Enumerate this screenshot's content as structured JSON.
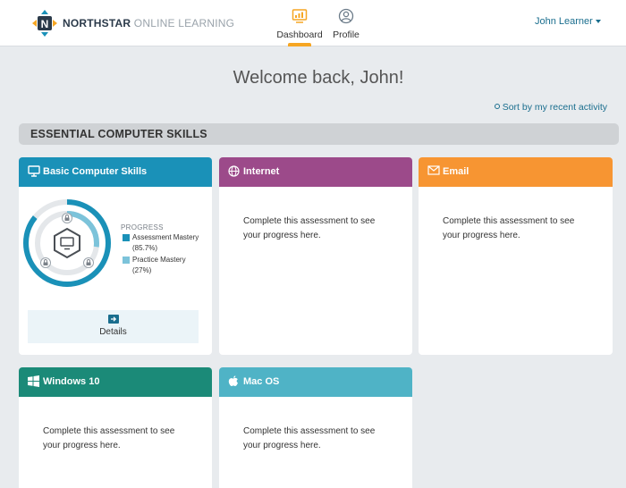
{
  "header": {
    "brand_bold": "NORTHSTAR",
    "brand_light": "ONLINE LEARNING",
    "nav": [
      {
        "label": "Dashboard",
        "icon": "dashboard-icon",
        "active": true
      },
      {
        "label": "Profile",
        "icon": "profile-icon",
        "active": false
      }
    ],
    "user_menu": "John Learner"
  },
  "welcome": "Welcome back, John!",
  "sort_link": "Sort by my recent activity",
  "section": {
    "title": "ESSENTIAL COMPUTER SKILLS"
  },
  "colors": {
    "basic": "#1a91b8",
    "internet": "#9c4a8a",
    "email": "#f79532",
    "windows": "#1b8a78",
    "macos": "#4fb3c6",
    "accent": "#f6a623",
    "link": "#1a6e8e"
  },
  "cards": [
    {
      "title": "Basic Computer Skills",
      "icon": "monitor-icon",
      "progress_label": "PROGRESS",
      "legend": [
        {
          "label": "Assessment Mastery",
          "value": "(85.7%)",
          "fraction": 0.857
        },
        {
          "label": "Practice Mastery",
          "value": "(27%)",
          "fraction": 0.27
        }
      ],
      "details_label": "Details"
    },
    {
      "title": "Internet",
      "icon": "globe-icon",
      "message": "Complete this assessment to see your progress here."
    },
    {
      "title": "Email",
      "icon": "envelope-icon",
      "message": "Complete this assessment to see your progress here."
    },
    {
      "title": "Windows 10",
      "icon": "windows-icon",
      "message": "Complete this assessment to see your progress here."
    },
    {
      "title": "Mac OS",
      "icon": "apple-icon",
      "message": "Complete this assessment to see your progress here."
    }
  ]
}
